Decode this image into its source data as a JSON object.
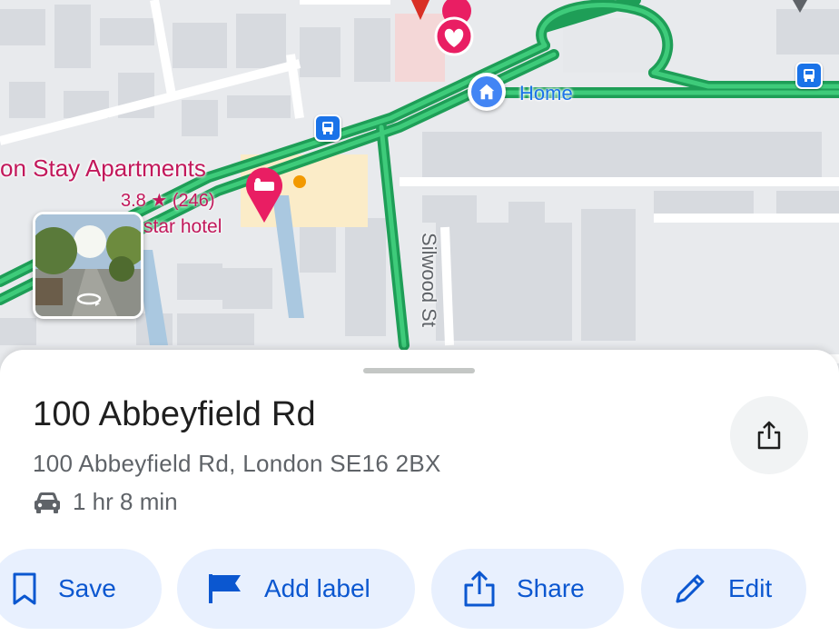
{
  "map": {
    "poi_name": "on Stay Apartments",
    "poi_rating": "3.8 ★ (246)",
    "poi_subtitle": "star hotel",
    "home_label": "Home",
    "street_label": "Silwood St"
  },
  "place": {
    "title": "100 Abbeyfield Rd",
    "address": "100 Abbeyfield Rd, London SE16 2BX",
    "drive_time": "1 hr 8 min"
  },
  "actions": {
    "save": "Save",
    "add_label": "Add label",
    "share": "Share",
    "edit": "Edit"
  },
  "colors": {
    "accent": "#0b57d0",
    "chip_bg": "#e8f0fe",
    "route_green": "#1e9e57",
    "poi_pink": "#e91e63"
  },
  "icons": {
    "drive": "car-icon",
    "share_top": "share-icon",
    "save": "bookmark-icon",
    "add_label": "flag-icon",
    "share": "share-icon",
    "edit": "pencil-icon"
  }
}
